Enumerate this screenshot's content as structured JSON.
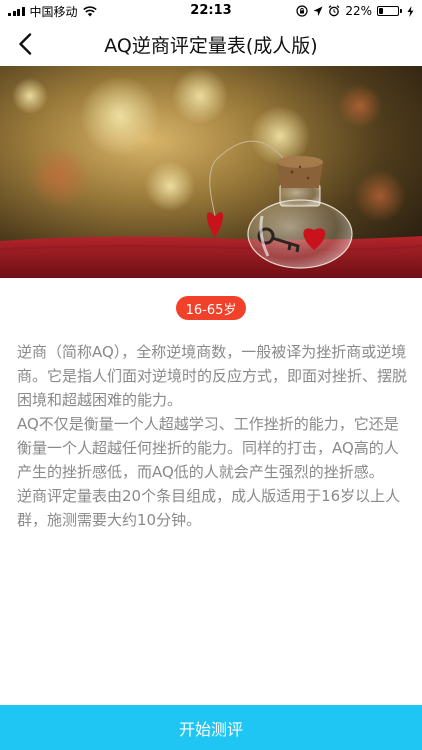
{
  "status_bar": {
    "carrier": "中国移动",
    "time": "22:13",
    "battery_percent": "22%",
    "battery_level": 0.22
  },
  "nav": {
    "title": "AQ逆商评定量表(成人版)",
    "back_icon": "chevron-left-icon"
  },
  "hero": {
    "description_icon": "jar-with-hearts-image"
  },
  "badge": {
    "age_range": "16-65岁",
    "color": "#f1412a"
  },
  "description": {
    "paragraphs": [
      "逆商（简称AQ），全称逆境商数，一般被译为挫折商或逆境商。它是指人们面对逆境时的反应方式，即面对挫折、摆脱困境和超越困难的能力。",
      "AQ不仅是衡量一个人超越学习、工作挫折的能力，它还是衡量一个人超越任何挫折的能力。同样的打击，AQ高的人产生的挫折感低，而AQ低的人就会产生强烈的挫折感。",
      "逆商评定量表由20个条目组成，成人版适用于16岁以上人群，施测需要大约10分钟。"
    ]
  },
  "actions": {
    "start_label": "开始测评",
    "button_color": "#1fc6f4"
  }
}
